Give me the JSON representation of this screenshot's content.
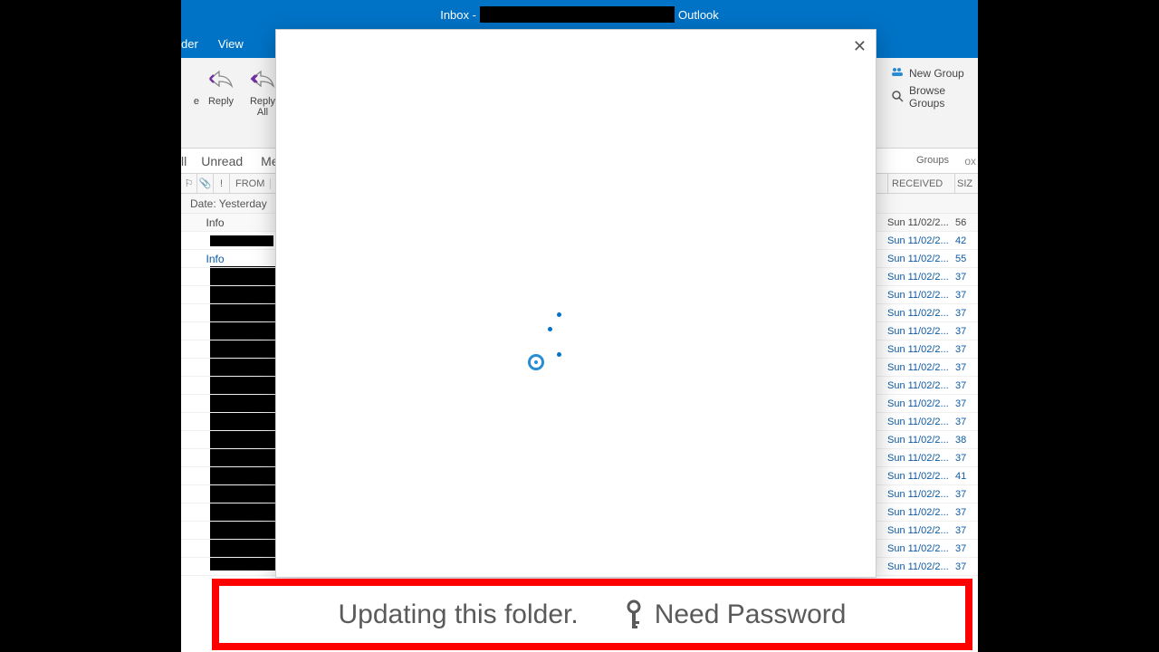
{
  "title": {
    "inbox": "Inbox",
    "dash": "-",
    "outlook": "Outlook"
  },
  "tabs": {
    "partial_folder": "der",
    "view": "View"
  },
  "ribbon": {
    "reply": "Reply",
    "reply_all_1": "Reply",
    "reply_all_2": "All",
    "partial_e": "e",
    "groups": {
      "new_group": "New Group",
      "browse_groups": "Browse Groups",
      "label": "Groups"
    }
  },
  "filters": {
    "all_partial": "ll",
    "unread": "Unread",
    "me_partial": "Me",
    "ox_partial": "ox"
  },
  "columns": {
    "from": "FROM",
    "received": "RECEIVED",
    "size": "SIZ"
  },
  "group_header": "Date: Yesterday",
  "row_common": {
    "info": "Info"
  },
  "rows": [
    {
      "date": "Sun 11/02/2...",
      "size": "56",
      "info": true,
      "redact": false
    },
    {
      "date": "Sun 11/02/2...",
      "size": "42",
      "info": false,
      "redact": true
    },
    {
      "date": "Sun 11/02/2...",
      "size": "55",
      "info": true,
      "redact": false
    },
    {
      "date": "Sun 11/02/2...",
      "size": "37",
      "info": false,
      "redact": false
    },
    {
      "date": "Sun 11/02/2...",
      "size": "37",
      "info": false,
      "redact": false
    },
    {
      "date": "Sun 11/02/2...",
      "size": "37",
      "info": false,
      "redact": false
    },
    {
      "date": "Sun 11/02/2...",
      "size": "37",
      "info": false,
      "redact": false
    },
    {
      "date": "Sun 11/02/2...",
      "size": "37",
      "info": false,
      "redact": false
    },
    {
      "date": "Sun 11/02/2...",
      "size": "37",
      "info": false,
      "redact": false
    },
    {
      "date": "Sun 11/02/2...",
      "size": "37",
      "info": false,
      "redact": false
    },
    {
      "date": "Sun 11/02/2...",
      "size": "37",
      "info": false,
      "redact": false
    },
    {
      "date": "Sun 11/02/2...",
      "size": "37",
      "info": false,
      "redact": false
    },
    {
      "date": "Sun 11/02/2...",
      "size": "38",
      "info": false,
      "redact": false
    },
    {
      "date": "Sun 11/02/2...",
      "size": "37",
      "info": false,
      "redact": false
    },
    {
      "date": "Sun 11/02/2...",
      "size": "41",
      "info": false,
      "redact": false
    },
    {
      "date": "Sun 11/02/2...",
      "size": "37",
      "info": false,
      "redact": false
    },
    {
      "date": "Sun 11/02/2...",
      "size": "37",
      "info": false,
      "redact": false
    },
    {
      "date": "Sun 11/02/2...",
      "size": "37",
      "info": false,
      "redact": false
    },
    {
      "date": "Sun 11/02/2...",
      "size": "37",
      "info": false,
      "redact": false
    },
    {
      "date": "Sun 11/02/2...",
      "size": "37",
      "info": false,
      "redact": false
    }
  ],
  "status": {
    "updating": "Updating this folder.",
    "need_password": "Need Password"
  },
  "dialog": {
    "close": "✕"
  }
}
